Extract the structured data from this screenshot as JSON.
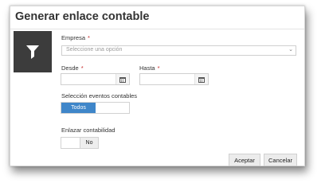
{
  "dialog": {
    "title": "Generar enlace contable",
    "icon": "filter-icon"
  },
  "form": {
    "empresa": {
      "label": "Empresa",
      "required_mark": "*",
      "placeholder": "Seleccione una opción"
    },
    "desde": {
      "label": "Desde",
      "required_mark": "*",
      "value": ""
    },
    "hasta": {
      "label": "Hasta",
      "required_mark": "*",
      "value": ""
    },
    "seleccion": {
      "label": "Selección eventos contables",
      "options": [
        "Todos",
        ""
      ],
      "selected": "Todos"
    },
    "enlazar": {
      "label": "Enlazar contabilidad",
      "value": "No"
    }
  },
  "buttons": {
    "accept": "Aceptar",
    "cancel": "Cancelar"
  },
  "colors": {
    "accent": "#3f86c9",
    "icon_bg": "#3c3c3c",
    "required": "#c62828"
  }
}
